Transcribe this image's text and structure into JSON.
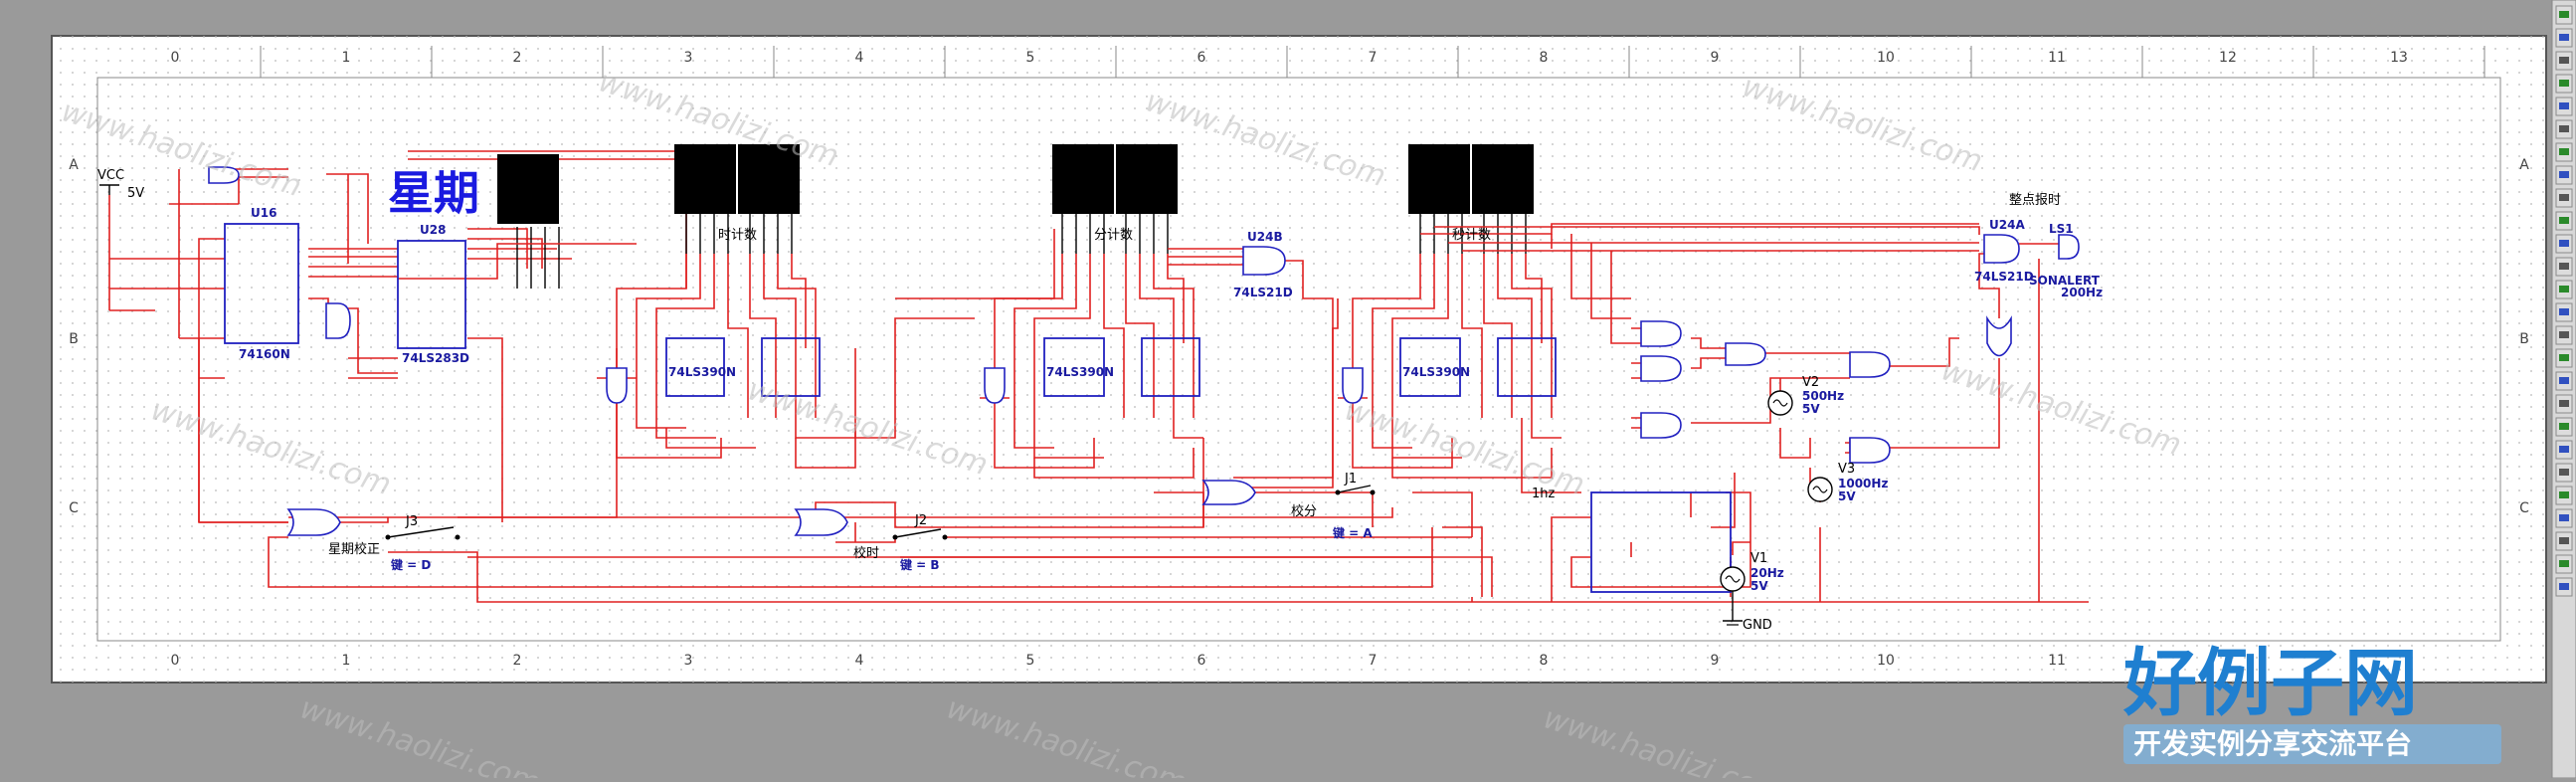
{
  "ruler": {
    "columns": [
      "0",
      "1",
      "2",
      "3",
      "4",
      "5",
      "6",
      "7",
      "8",
      "9",
      "10",
      "11",
      "12",
      "13"
    ],
    "bottom_columns": [
      "0",
      "1",
      "2",
      "3",
      "4",
      "5",
      "6",
      "7",
      "8",
      "9",
      "10",
      "11"
    ],
    "rows": [
      "A",
      "B",
      "C"
    ]
  },
  "title_weekday": "星期",
  "labels": {
    "hour_count": "时计数",
    "minute_count": "分计数",
    "second_count": "秒计数",
    "hourly_chime": "整点报时",
    "weekday_adjust": "星期校正",
    "hour_adjust": "校时",
    "minute_adjust": "校分",
    "one_hz": "1hz"
  },
  "components": {
    "vcc": "VCC",
    "vcc_value": "5V",
    "u16": "U16",
    "u16_part": "74160N",
    "u28": "U28",
    "u28_part": "74LS283D",
    "u24b": "U24B",
    "u24b_part": "74LS21D",
    "u24a": "U24A",
    "u24a_part": "74LS21D",
    "ls1": "LS1",
    "ls1_part": "SONALERT",
    "ls1_freq": "200Hz",
    "cnt_hour_a": "74LS390N",
    "cnt_min_a": "74LS390N",
    "cnt_sec_a": "74LS390N",
    "j1": "J1",
    "j1_key": "键 = A",
    "j2": "J2",
    "j2_key": "键 = B",
    "j3": "J3",
    "j3_key": "键 = D",
    "v1": "V1",
    "v1_freq": "20Hz",
    "v1_volt": "5V",
    "v2": "V2",
    "v2_freq": "500Hz",
    "v2_volt": "5V",
    "v3": "V3",
    "v3_freq": "1000Hz",
    "v3_volt": "5V",
    "gnd": "GND"
  },
  "watermark": {
    "brand": "好例子网",
    "slogan": "开发实例分享交流平台",
    "url": "www.haolizi.com"
  },
  "colors": {
    "background": "#9a9a9a",
    "sheet": "#ffffff",
    "wire": "#e02020",
    "component": "#2020c0",
    "brand": "#1f7fd0"
  }
}
